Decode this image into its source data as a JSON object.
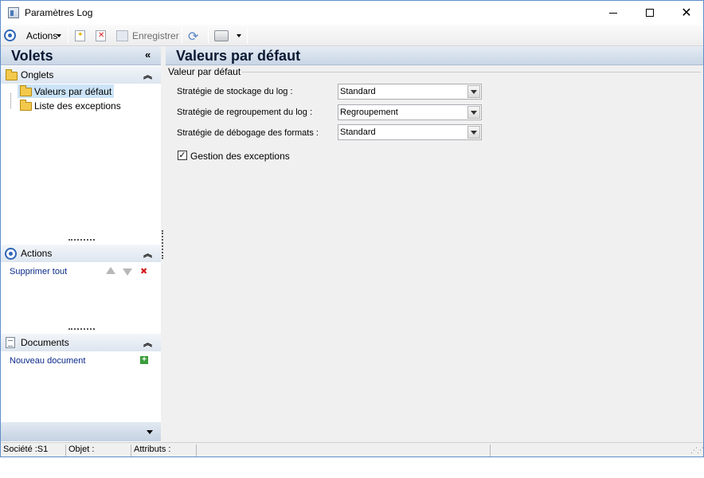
{
  "window": {
    "title": "Paramètres Log"
  },
  "toolbar": {
    "actions_label": "Actions",
    "save_label": "Enregistrer"
  },
  "left_pane": {
    "title": "Volets",
    "onglets": {
      "title": "Onglets",
      "items": [
        {
          "label": "Valeurs par défaut",
          "selected": true
        },
        {
          "label": "Liste des exceptions",
          "selected": false
        }
      ]
    },
    "actions": {
      "title": "Actions",
      "link": "Supprimer tout"
    },
    "documents": {
      "title": "Documents",
      "link": "Nouveau document"
    }
  },
  "main": {
    "title": "Valeurs par défaut",
    "group_label": "Valeur par défaut",
    "fields": [
      {
        "label": "Stratégie de stockage du log :",
        "value": "Standard"
      },
      {
        "label": "Stratégie de regroupement du log :",
        "value": "Regroupement"
      },
      {
        "label": "Stratégie de débogage des formats :",
        "value": "Standard"
      }
    ],
    "checkbox": {
      "label": "Gestion des exceptions",
      "checked": true,
      "mark": "✓"
    }
  },
  "statusbar": {
    "societe": "Société :S1",
    "objet": "Objet :",
    "attributs": "Attributs :"
  }
}
